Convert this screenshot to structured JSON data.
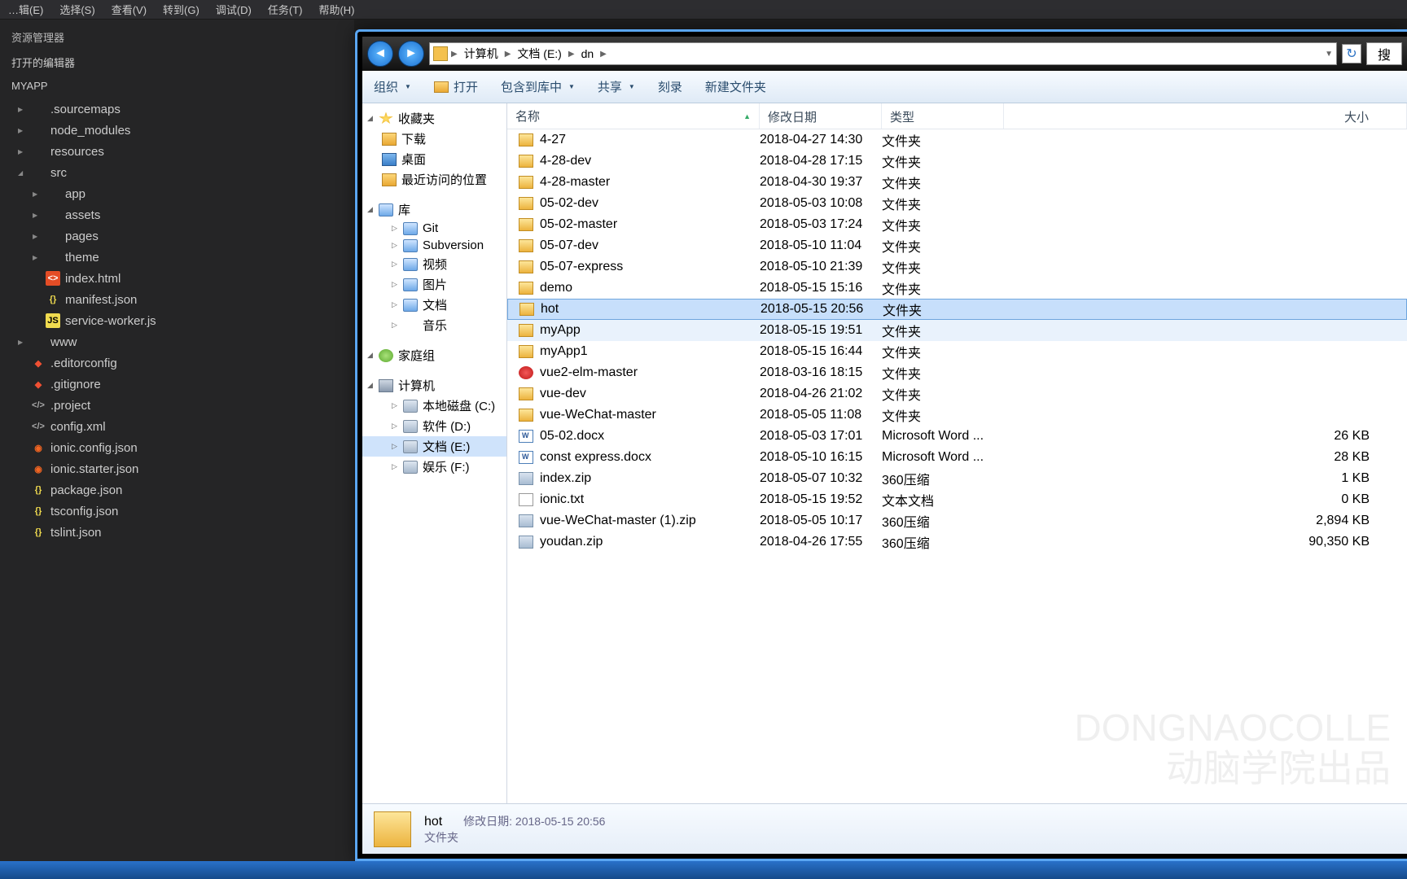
{
  "menu": [
    "…辑(E)",
    "选择(S)",
    "查看(V)",
    "转到(G)",
    "调试(D)",
    "任务(T)",
    "帮助(H)"
  ],
  "sidebar": {
    "title": "资源管理器",
    "section": "打开的编辑器",
    "project": "MYAPP",
    "tree": [
      {
        "caret": "right",
        "icon": "folder",
        "label": ".sourcemaps",
        "indent": 1
      },
      {
        "caret": "right",
        "icon": "folder",
        "label": "node_modules",
        "indent": 1
      },
      {
        "caret": "right",
        "icon": "folder",
        "label": "resources",
        "indent": 1
      },
      {
        "caret": "down",
        "icon": "folder",
        "label": "src",
        "indent": 1
      },
      {
        "caret": "right",
        "icon": "folder",
        "label": "app",
        "indent": 2
      },
      {
        "caret": "right",
        "icon": "folder",
        "label": "assets",
        "indent": 2
      },
      {
        "caret": "right",
        "icon": "folder",
        "label": "pages",
        "indent": 2
      },
      {
        "caret": "right",
        "icon": "folder",
        "label": "theme",
        "indent": 2
      },
      {
        "caret": "",
        "icon": "html",
        "label": "index.html",
        "indent": 2
      },
      {
        "caret": "",
        "icon": "json",
        "label": "manifest.json",
        "indent": 2
      },
      {
        "caret": "",
        "icon": "js",
        "label": "service-worker.js",
        "indent": 2
      },
      {
        "caret": "right",
        "icon": "folder",
        "label": "www",
        "indent": 1
      },
      {
        "caret": "",
        "icon": "git",
        "label": ".editorconfig",
        "indent": 1
      },
      {
        "caret": "",
        "icon": "git",
        "label": ".gitignore",
        "indent": 1
      },
      {
        "caret": "",
        "icon": "xml",
        "label": ".project",
        "indent": 1
      },
      {
        "caret": "",
        "icon": "xml",
        "label": "config.xml",
        "indent": 1
      },
      {
        "caret": "",
        "icon": "rss",
        "label": "ionic.config.json",
        "indent": 1
      },
      {
        "caret": "",
        "icon": "rss",
        "label": "ionic.starter.json",
        "indent": 1
      },
      {
        "caret": "",
        "icon": "json",
        "label": "package.json",
        "indent": 1
      },
      {
        "caret": "",
        "icon": "json",
        "label": "tsconfig.json",
        "indent": 1
      },
      {
        "caret": "",
        "icon": "json",
        "label": "tslint.json",
        "indent": 1
      }
    ]
  },
  "explorer": {
    "breadcrumb": [
      "计算机",
      "文档 (E:)",
      "dn"
    ],
    "search_placeholder": "搜",
    "toolbar": {
      "organize": "组织",
      "open": "打开",
      "include": "包含到库中",
      "share": "共享",
      "burn": "刻录",
      "newfolder": "新建文件夹"
    },
    "nav": {
      "favorites": {
        "head": "收藏夹",
        "items": [
          "下载",
          "桌面",
          "最近访问的位置"
        ]
      },
      "libraries": {
        "head": "库",
        "items": [
          "Git",
          "Subversion",
          "视频",
          "图片",
          "文档",
          "音乐"
        ]
      },
      "homegroup": "家庭组",
      "computer": {
        "head": "计算机",
        "items": [
          "本地磁盘 (C:)",
          "软件 (D:)",
          "文档 (E:)",
          "娱乐 (F:)"
        ]
      }
    },
    "columns": {
      "name": "名称",
      "date": "修改日期",
      "type": "类型",
      "size": "大小"
    },
    "rows": [
      {
        "icon": "folder",
        "name": "4-27",
        "date": "2018-04-27 14:30",
        "type": "文件夹",
        "size": ""
      },
      {
        "icon": "folder",
        "name": "4-28-dev",
        "date": "2018-04-28 17:15",
        "type": "文件夹",
        "size": ""
      },
      {
        "icon": "folder",
        "name": "4-28-master",
        "date": "2018-04-30 19:37",
        "type": "文件夹",
        "size": ""
      },
      {
        "icon": "folder",
        "name": "05-02-dev",
        "date": "2018-05-03 10:08",
        "type": "文件夹",
        "size": ""
      },
      {
        "icon": "folder",
        "name": "05-02-master",
        "date": "2018-05-03 17:24",
        "type": "文件夹",
        "size": ""
      },
      {
        "icon": "folder",
        "name": "05-07-dev",
        "date": "2018-05-10 11:04",
        "type": "文件夹",
        "size": ""
      },
      {
        "icon": "folder",
        "name": "05-07-express",
        "date": "2018-05-10 21:39",
        "type": "文件夹",
        "size": ""
      },
      {
        "icon": "folder",
        "name": "demo",
        "date": "2018-05-15 15:16",
        "type": "文件夹",
        "size": ""
      },
      {
        "icon": "folder",
        "name": "hot",
        "date": "2018-05-15 20:56",
        "type": "文件夹",
        "size": "",
        "selected": true
      },
      {
        "icon": "folder",
        "name": "myApp",
        "date": "2018-05-15 19:51",
        "type": "文件夹",
        "size": "",
        "subselected": true
      },
      {
        "icon": "folder",
        "name": "myApp1",
        "date": "2018-05-15 16:44",
        "type": "文件夹",
        "size": ""
      },
      {
        "icon": "warn",
        "name": "vue2-elm-master",
        "date": "2018-03-16 18:15",
        "type": "文件夹",
        "size": ""
      },
      {
        "icon": "folder",
        "name": "vue-dev",
        "date": "2018-04-26 21:02",
        "type": "文件夹",
        "size": ""
      },
      {
        "icon": "folder",
        "name": "vue-WeChat-master",
        "date": "2018-05-05 11:08",
        "type": "文件夹",
        "size": ""
      },
      {
        "icon": "doc",
        "name": "05-02.docx",
        "date": "2018-05-03 17:01",
        "type": "Microsoft Word ...",
        "size": "26 KB"
      },
      {
        "icon": "doc",
        "name": "const express.docx",
        "date": "2018-05-10 16:15",
        "type": "Microsoft Word ...",
        "size": "28 KB"
      },
      {
        "icon": "zip",
        "name": "index.zip",
        "date": "2018-05-07 10:32",
        "type": "360压缩",
        "size": "1 KB"
      },
      {
        "icon": "txt",
        "name": "ionic.txt",
        "date": "2018-05-15 19:52",
        "type": "文本文档",
        "size": "0 KB"
      },
      {
        "icon": "zip",
        "name": "vue-WeChat-master (1).zip",
        "date": "2018-05-05 10:17",
        "type": "360压缩",
        "size": "2,894 KB"
      },
      {
        "icon": "zip",
        "name": "youdan.zip",
        "date": "2018-04-26 17:55",
        "type": "360压缩",
        "size": "90,350 KB"
      }
    ],
    "details": {
      "name": "hot",
      "type": "文件夹",
      "modlabel": "修改日期:",
      "mod": "2018-05-15 20:56"
    }
  },
  "watermark": {
    "line1": "动脑学院出品",
    "line2": "DONGNAOCOLLE"
  }
}
